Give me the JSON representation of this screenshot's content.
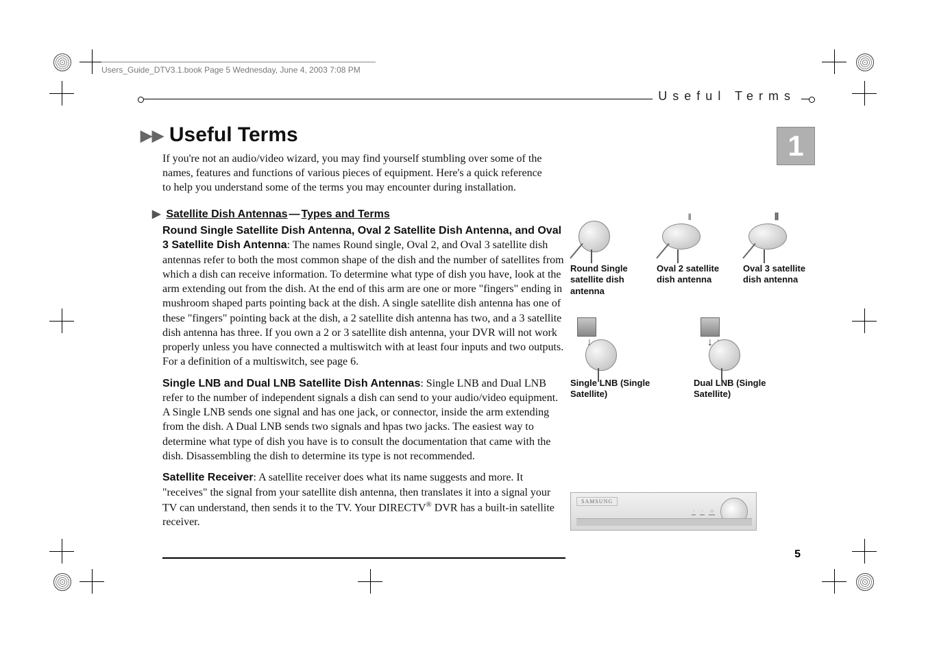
{
  "header": {
    "book_line": "Users_Guide_DTV3.1.book  Page 5  Wednesday, June 4, 2003  7:08 PM",
    "running_head": "Useful Terms"
  },
  "chapter": {
    "number": "1",
    "title": "Useful Terms",
    "intro": "If you're not an audio/video wizard, you may find yourself stumbling over some of the names, features and functions of various pieces of equipment. Here's a quick reference to help you understand some of the terms you may encounter during installation."
  },
  "subheading": {
    "part1": "Satellite Dish Antennas",
    "part2": "Types and Terms"
  },
  "paragraphs": {
    "p1_lead": "Round Single Satellite Dish Antenna, Oval 2 Satellite Dish Antenna, and Oval 3 Satellite Dish Antenna",
    "p1_body": ": The names Round single, Oval 2, and Oval 3 satellite dish antennas refer to both the most common shape of the dish and the number of satellites from which a dish can receive information. To determine what type of dish you have, look at the arm extending out from the dish. At the end of this arm are one or more \"fingers\" ending in mushroom shaped parts pointing back at the dish. A single satellite dish antenna has one of these \"fingers\" pointing back at the dish, a 2 satellite dish antenna has two, and a 3 satellite dish antenna has three. If you own a 2 or 3 satellite dish antenna, your DVR will not work properly unless you have connected a multiswitch with at least four inputs and two outputs. For a definition of a multiswitch, see page 6.",
    "p2_lead": "Single LNB and Dual LNB Satellite Dish Antennas",
    "p2_body": ": Single LNB and Dual LNB refer to the number of independent signals a dish can send to your audio/video equipment. A Single LNB sends one signal and has one jack, or connector, inside the arm extending from the dish. A Dual LNB sends two signals and hpas two jacks. The easiest way to determine what type of dish you have is to consult the documentation that came with the dish. Disassembling the dish to determine its type is not recommended.",
    "p3_lead": "Satellite Receiver",
    "p3_body_a": ": A satellite receiver does what its name suggests and more. It \"receives\" the signal from your satellite dish antenna, then translates it into a signal your TV can understand, then sends it to the TV. Your DIRECTV",
    "p3_sup": "®",
    "p3_body_b": " DVR has a built-in satellite receiver."
  },
  "figures": {
    "round": "Round Single satellite dish antenna",
    "oval2": "Oval 2 satellite dish antenna",
    "oval3": "Oval 3 satellite dish antenna",
    "single_lnb": "Single LNB (Single Satellite)",
    "dual_lnb": "Dual LNB (Single Satellite)",
    "receiver_brand": "SAMSUNG"
  },
  "page_number": "5"
}
